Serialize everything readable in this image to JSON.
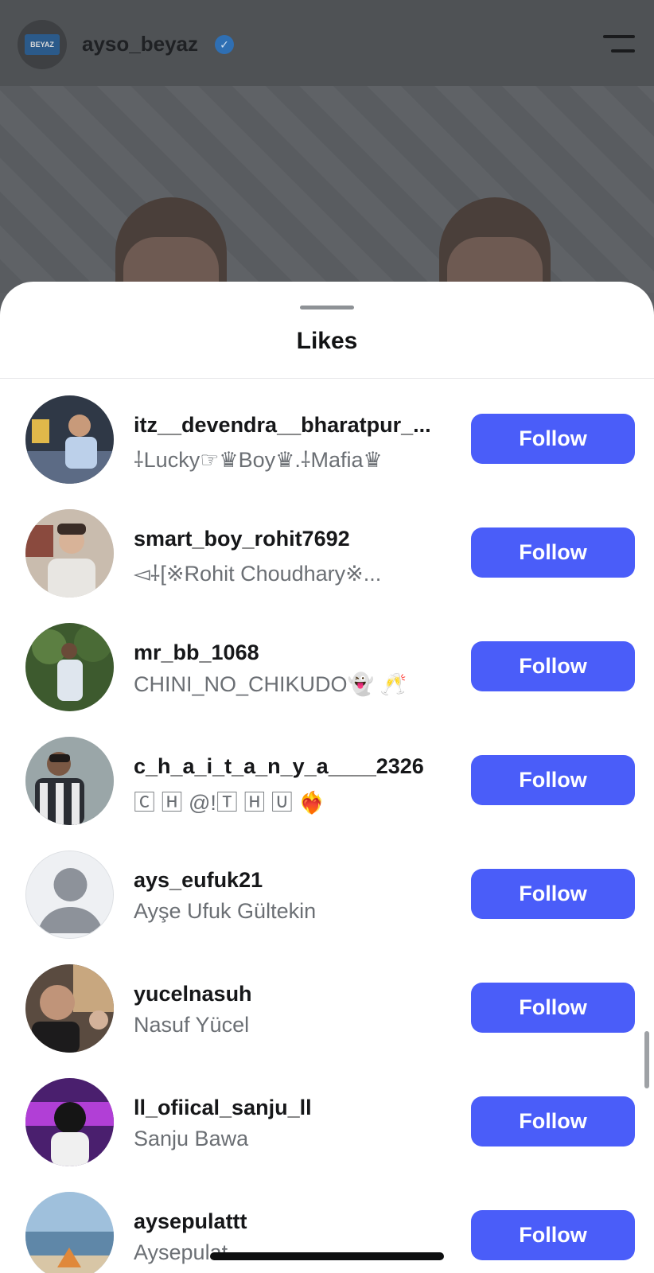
{
  "post_header": {
    "avatar_text": "BEYAZ",
    "username": "ayso_beyaz",
    "verified_icon": "verified-badge-icon",
    "menu_icon": "hamburger-menu-icon"
  },
  "sheet": {
    "title": "Likes"
  },
  "likes": [
    {
      "username": "itz__devendra__bharatpur_...",
      "full_name": "⸸Lucky☞♛Boy♛.⸸Mafia♛",
      "avatar_color": "#7a8fb0",
      "follow_label": "Follow"
    },
    {
      "username": "smart_boy_rohit7692",
      "full_name": "◅⸸[※Rohit Choudhary※...",
      "avatar_color": "#b9a89a",
      "follow_label": "Follow"
    },
    {
      "username": "mr_bb_1068",
      "full_name": "CHINI_NO_CHIKUDO👻 🥂",
      "avatar_color": "#4f6a3e",
      "follow_label": "Follow"
    },
    {
      "username": "c_h_a_i_t_a_n_y_a____2326",
      "full_name": "🄲 🄷 @!🅃 🄷 🅄 ❤️‍🔥",
      "avatar_color": "#4b4f58",
      "follow_label": "Follow"
    },
    {
      "username": "ays_eufuk21",
      "full_name": "Ayşe Ufuk Gültekin",
      "avatar_color": "#eef0f3",
      "follow_label": "Follow"
    },
    {
      "username": "yucelnasuh",
      "full_name": "Nasuf Yücel",
      "avatar_color": "#6b5a4b",
      "follow_label": "Follow"
    },
    {
      "username": "ll_ofiical_sanju_ll",
      "full_name": "Sanju Bawa",
      "avatar_color": "#5a2f86",
      "follow_label": "Follow"
    },
    {
      "username": "aysepulattt",
      "full_name": "Aysepulat",
      "avatar_color": "#8fb2cf",
      "follow_label": "Follow"
    }
  ],
  "colors": {
    "follow_button": "#4a5df9",
    "sheet_bg": "#ffffff",
    "overlay_bg": "#5b5e62"
  }
}
